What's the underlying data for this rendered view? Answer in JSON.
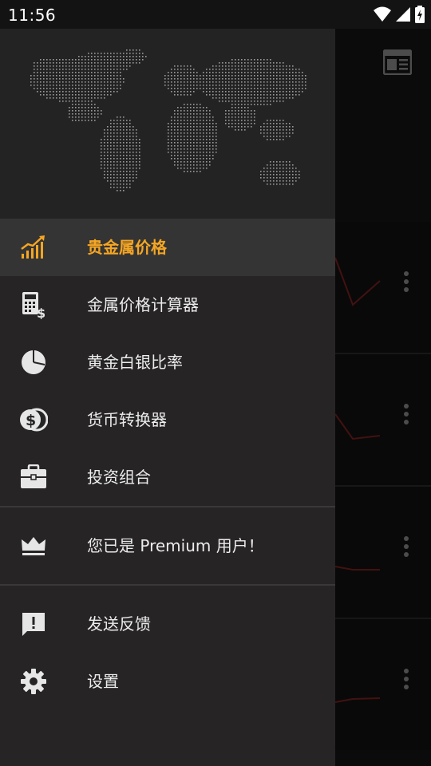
{
  "status_bar": {
    "time": "11:56"
  },
  "drawer": {
    "main_items": [
      {
        "label": "贵金属价格",
        "icon": "trending-up-chart-icon",
        "active": true
      },
      {
        "label": "金属价格计算器",
        "icon": "calculator-icon",
        "active": false
      },
      {
        "label": "黄金白银比率",
        "icon": "pie-chart-icon",
        "active": false
      },
      {
        "label": "货币转换器",
        "icon": "currency-coins-icon",
        "active": false
      },
      {
        "label": "投资组合",
        "icon": "briefcase-icon",
        "active": false
      }
    ],
    "premium": {
      "label": "您已是 Premium 用户！",
      "icon": "crown-icon"
    },
    "secondary_items": [
      {
        "label": "发送反馈",
        "icon": "feedback-icon"
      },
      {
        "label": "设置",
        "icon": "gear-icon"
      }
    ]
  },
  "colors": {
    "accent": "#f5a623",
    "drawer_bg": "#262424",
    "active_bg": "#353434",
    "text": "#ececec",
    "chart_line": "#7a2020"
  }
}
